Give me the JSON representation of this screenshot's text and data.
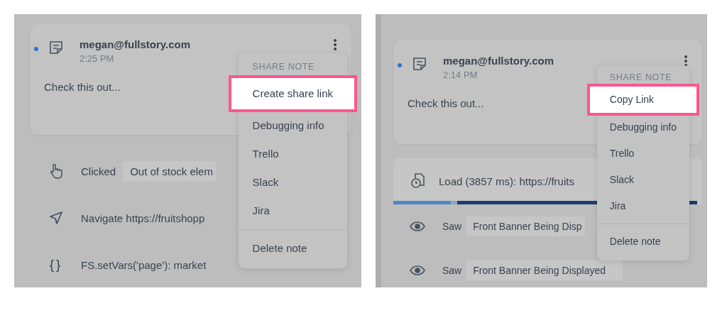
{
  "panels": [
    {
      "note": {
        "unread": true,
        "author": "megan@fullstory.com",
        "time": "2:25 PM",
        "text": "Check this out..."
      },
      "menu": {
        "header": "SHARE NOTE",
        "items": [
          {
            "label": "Create share link",
            "selected": true
          },
          {
            "label": "Debugging info",
            "selected": false
          },
          {
            "label": "Trello",
            "selected": false
          },
          {
            "label": "Slack",
            "selected": false
          },
          {
            "label": "Jira",
            "selected": false
          }
        ],
        "footer": "Delete note"
      },
      "events": [
        {
          "kind": "click",
          "verb": "Clicked",
          "target": "Out of stock elem"
        },
        {
          "kind": "navigate",
          "text": "Navigate https://fruitshopp"
        },
        {
          "kind": "vars",
          "glyph": "{}",
          "text": "FS.setVars('page'): market"
        }
      ]
    },
    {
      "note": {
        "unread": true,
        "author": "megan@fullstory.com",
        "time": "2:14 PM",
        "text": "Check this out..."
      },
      "menu": {
        "header": "SHARE NOTE",
        "items": [
          {
            "label": "Copy Link",
            "selected": true
          },
          {
            "label": "Debugging info",
            "selected": false
          },
          {
            "label": "Trello",
            "selected": false
          },
          {
            "label": "Slack",
            "selected": false
          },
          {
            "label": "Jira",
            "selected": false
          }
        ],
        "footer": "Delete note"
      },
      "events": [
        {
          "kind": "load",
          "text": "Load (3857 ms): https://fruits"
        },
        {
          "kind": "saw",
          "verb": "Saw",
          "target": "Front Banner Being Disp"
        },
        {
          "kind": "saw",
          "verb": "Saw",
          "target": "Front Banner Being Displayed"
        }
      ]
    }
  ]
}
